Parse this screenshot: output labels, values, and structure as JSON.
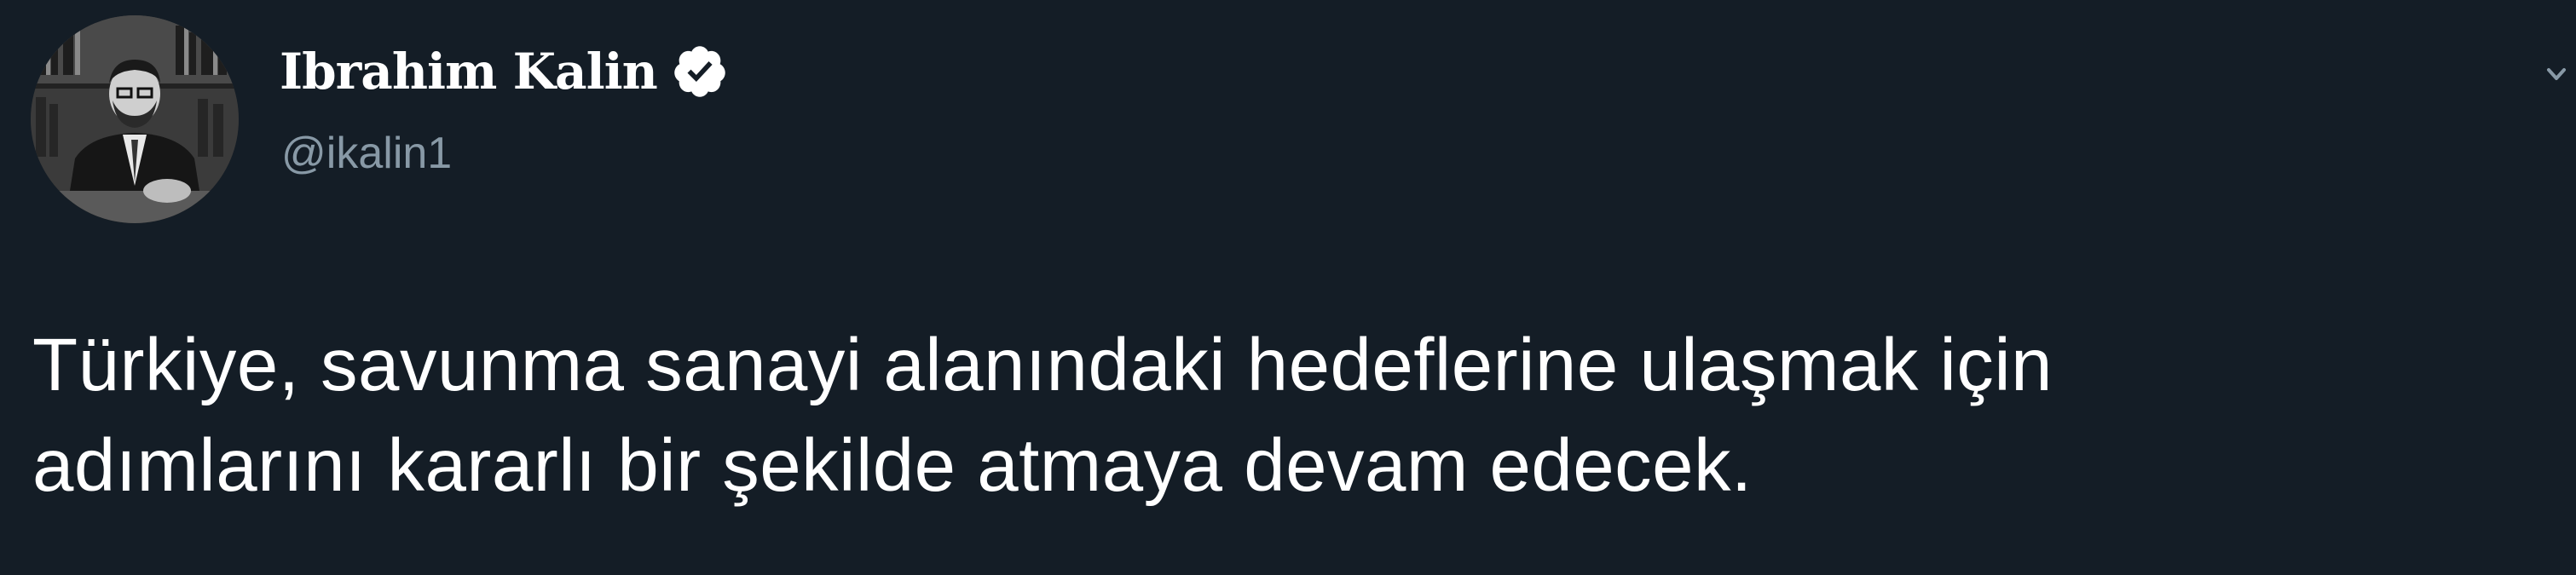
{
  "author": {
    "display_name": "Ibrahim Kalin",
    "handle": "@ikalin1",
    "verified": true,
    "avatar": "profile-photo"
  },
  "tweet": {
    "lines": [
      "Türkiye, savunma sanayi alanındaki hedeflerine ulaşmak için",
      "adımlarını kararlı bir şekilde atmaya devam edecek."
    ]
  },
  "icons": {
    "verified": "verified-badge-icon",
    "more": "chevron-down-icon"
  },
  "colors": {
    "background": "#141d26",
    "text": "#ffffff",
    "handle": "#8899a6"
  }
}
